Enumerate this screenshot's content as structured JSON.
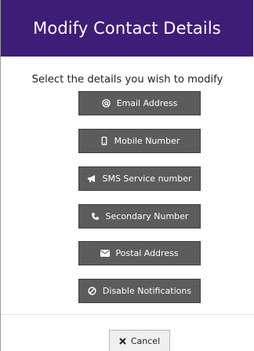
{
  "dialog": {
    "title": "Modify Contact Details",
    "prompt": "Select the details you wish to modify",
    "options": [
      {
        "label": "Email Address",
        "icon": "at-icon"
      },
      {
        "label": "Mobile Number",
        "icon": "mobile-phone-icon"
      },
      {
        "label": "SMS Service number",
        "icon": "megaphone-icon"
      },
      {
        "label": "Secondary Number",
        "icon": "phone-icon"
      },
      {
        "label": "Postal Address",
        "icon": "envelope-icon"
      },
      {
        "label": "Disable Notifications",
        "icon": "ban-icon"
      }
    ],
    "cancel_label": "Cancel",
    "cancel_icon": "close-icon"
  },
  "colors": {
    "header_bg": "#3e1d78",
    "button_bg": "#5c5c5c",
    "cancel_bg": "#efefef"
  }
}
